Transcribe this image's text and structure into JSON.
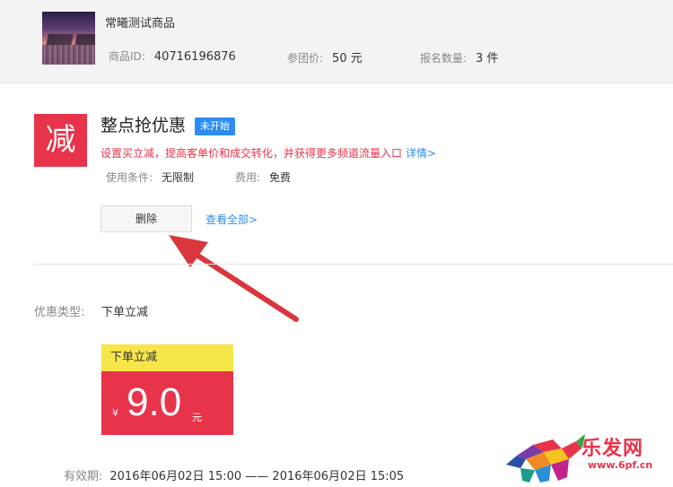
{
  "product": {
    "name": "常曦测试商品",
    "id_label": "商品ID:",
    "id_value": "40716196876",
    "price_label": "参团价:",
    "price_value": "50 元",
    "qty_label": "报名数量:",
    "qty_value": "3 件"
  },
  "promotion": {
    "icon_char": "减",
    "title": "整点抢优惠",
    "status": "未开始",
    "description": "设置买立减，提高客单价和成交转化，并获得更多频道流量入口",
    "detail_link": "详情>",
    "condition_label": "使用条件:",
    "condition_value": "无限制",
    "fee_label": "费用:",
    "fee_value": "免费",
    "delete_label": "删除",
    "view_all_label": "查看全部>"
  },
  "discount": {
    "type_label": "优惠类型:",
    "type_value": "下单立减",
    "coupon_title": "下单立减",
    "currency": "¥",
    "amount": "9.0",
    "unit": "元"
  },
  "validity": {
    "label": "有效期:",
    "value": "2016年06月02日 15:00 —— 2016年06月02日 15:05"
  },
  "watermark": {
    "brand": "乐发网",
    "url": "www.6pf.cn"
  },
  "colors": {
    "accent_red": "#e8344a",
    "link_blue": "#2d8cf0",
    "coupon_yellow": "#f6e64a",
    "arrow_red": "#d9363e"
  }
}
